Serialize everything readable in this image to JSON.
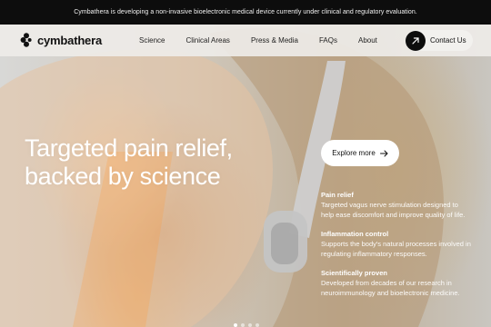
{
  "announcement": {
    "text": "Cymbathera is developing a non-invasive bioelectronic medical device currently under clinical and regulatory evaluation."
  },
  "nav": {
    "logo_text": "cymbathera",
    "links": [
      "Science",
      "Clinical Areas",
      "Press & Media",
      "FAQs",
      "About"
    ],
    "cta_label": "Contact Us"
  },
  "hero": {
    "headline_line1": "Targeted pain relief,",
    "headline_line2": "backed by science",
    "explore_label": "Explore more",
    "features": [
      {
        "title": "Pain relief",
        "desc": "Targeted vagus nerve stimulation designed to help ease discomfort and improve quality of life."
      },
      {
        "title": "Inflammation control",
        "desc": "Supports the body's natural processes involved in regulating inflammatory responses."
      },
      {
        "title": "Scientifically proven",
        "desc": "Developed from decades of our research in neuroimmunology and bioelectronic medicine."
      }
    ],
    "slide_count": 4,
    "active_slide": 1
  },
  "colors": {
    "announcement_bg": "#0d0d0d",
    "nav_bg": "#eeece8",
    "cta_circle": "#0d0d0d",
    "text_on_hero": "#ffffff"
  },
  "icons": {
    "logo": "cymbathera-logo-icon",
    "cta": "arrow-up-right-icon",
    "explore": "arrow-right-icon"
  }
}
